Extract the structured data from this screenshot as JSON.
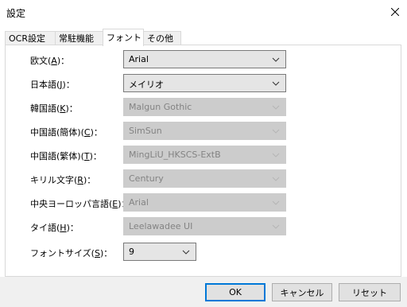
{
  "window": {
    "title": "設定"
  },
  "tabs": [
    {
      "label": "OCR設定"
    },
    {
      "label": "常駐機能"
    },
    {
      "label": "フォント"
    },
    {
      "label": "その他"
    }
  ],
  "fonts": {
    "rows": [
      {
        "label_pre": "欧文(",
        "key": "A",
        "label_post": ")：",
        "value": "Arial",
        "enabled": true
      },
      {
        "label_pre": "日本語(",
        "key": "J",
        "label_post": ")：",
        "value": "メイリオ",
        "enabled": true
      },
      {
        "label_pre": "韓国語(",
        "key": "K",
        "label_post": ")：",
        "value": "Malgun Gothic",
        "enabled": false
      },
      {
        "label_pre": "中国語(簡体)(",
        "key": "C",
        "label_post": ")：",
        "value": "SimSun",
        "enabled": false
      },
      {
        "label_pre": "中国語(繁体)(",
        "key": "T",
        "label_post": ")：",
        "value": "MingLiU_HKSCS-ExtB",
        "enabled": false
      },
      {
        "label_pre": "キリル文字(",
        "key": "R",
        "label_post": ")：",
        "value": "Century",
        "enabled": false
      },
      {
        "label_pre": "中央ヨーロッパ言語(",
        "key": "E",
        "label_post": ")：",
        "value": "Arial",
        "enabled": false
      },
      {
        "label_pre": "タイ語(",
        "key": "H",
        "label_post": ")：",
        "value": "Leelawadee UI",
        "enabled": false
      }
    ],
    "size": {
      "label_pre": "フォントサイズ(",
      "key": "S",
      "label_post": ")：",
      "value": "9"
    }
  },
  "buttons": {
    "ok": "OK",
    "cancel": "キャンセル",
    "reset": "リセット"
  },
  "icons": {
    "close": "close-icon",
    "dropdown": "chevron-down-icon"
  }
}
